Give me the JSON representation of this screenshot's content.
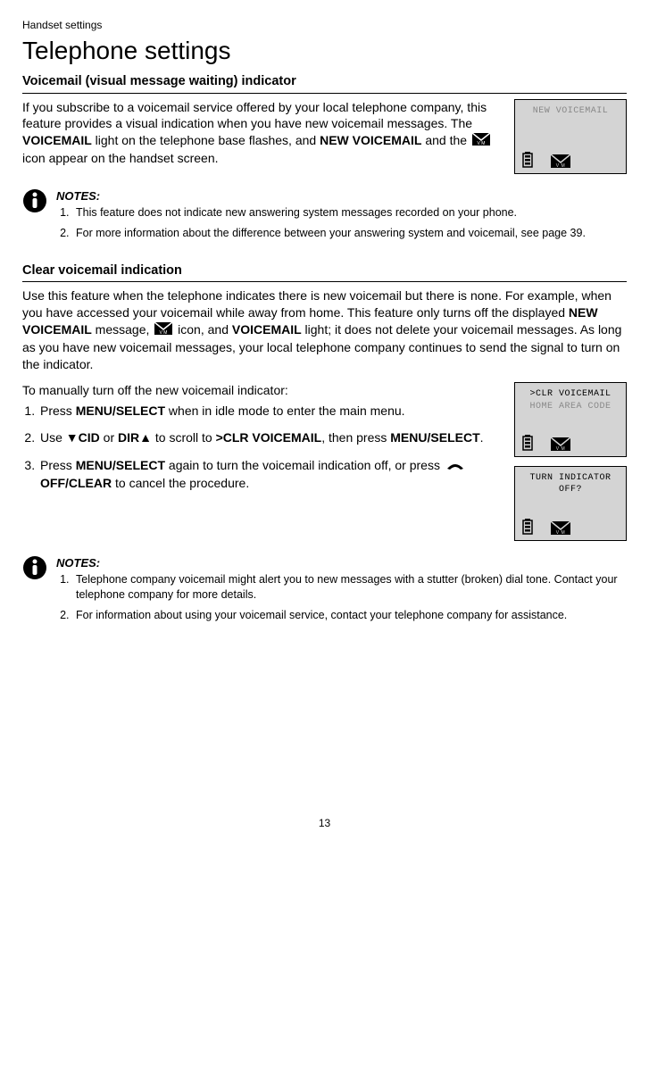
{
  "breadcrumb": "Handset settings",
  "page_title": "Telephone settings",
  "section1": {
    "heading": "Voicemail (visual message waiting) indicator",
    "body_pre": "If you subscribe to a voicemail service offered by your local telephone company, this feature provides a visual indication when you have new voicemail messages. The ",
    "voicemail_word": "VOICEMAIL",
    "body_mid1": " light on the telephone base flashes, and ",
    "new_voicemail": "NEW VOICEMAIL",
    "body_mid2": " and the ",
    "body_post": " icon appear on the handset screen."
  },
  "lcd1": {
    "line1": "NEW VOICEMAIL"
  },
  "notes_label": "NOTES:",
  "notes1": [
    "This feature does not indicate new answering system messages recorded on your phone.",
    "For more information about the difference between your answering system and voicemail, see page 39."
  ],
  "section2": {
    "heading": "Clear voicemail indication",
    "body_pre": "Use this feature when the telephone indicates there is new voicemail but there is none. For example, when you have accessed your voicemail while away from home. This feature only turns off the displayed ",
    "new_voicemail": "NEW VOICEMAIL",
    "body_mid1": " message, ",
    "body_mid2": " icon, and ",
    "voicemail_word": "VOICEMAIL",
    "body_post": " light; it does not delete your voicemail messages. As long as you have new voicemail messages, your local telephone company continues to send the signal to turn on the indicator.",
    "intro_steps": "To manually turn off the new voicemail indicator:",
    "step1_a": "Press ",
    "step1_b": "MENU/",
    "step1_c": "SELECT",
    "step1_d": " when in idle mode to enter the main menu.",
    "step2_a": "Use ",
    "step2_b": "CID",
    "step2_c": " or ",
    "step2_d": "DIR",
    "step2_e": " to scroll to ",
    "step2_f": ">CLR VOICEMAIL",
    "step2_g": ", then press ",
    "step2_h": "MENU",
    "step2_i": "/SELECT",
    "step2_j": ".",
    "step3_a": "Press ",
    "step3_b": "MENU",
    "step3_c": "/SELECT",
    "step3_d": " again to turn the voicemail indication off, or press ",
    "step3_e": "OFF",
    "step3_f": "/CLEAR",
    "step3_g": " to cancel the procedure."
  },
  "lcd2": {
    "line1": ">CLR VOICEMAIL",
    "line2": "HOME AREA CODE"
  },
  "lcd3": {
    "line1": "TURN INDICATOR",
    "line2": "OFF?"
  },
  "notes2": [
    "Telephone company voicemail might alert you to new messages with a stutter (broken) dial tone. Contact your telephone company for more details.",
    "For information about using your voicemail service, contact your telephone company for assistance."
  ],
  "page_number": "13"
}
